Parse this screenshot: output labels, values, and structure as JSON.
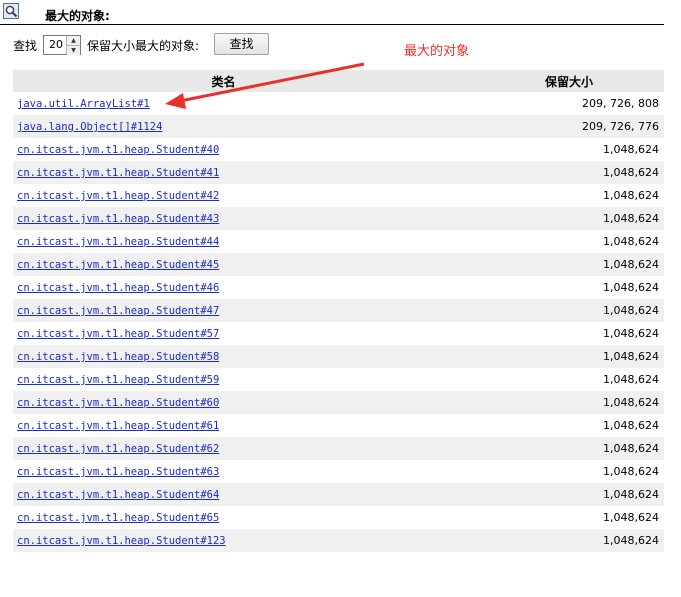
{
  "header": {
    "title": "最大的对象:",
    "icon": "magnifier-icon"
  },
  "search": {
    "label_find": "查找",
    "count": "20",
    "label_suffix": "保留大小最大的对象:",
    "button": "查找"
  },
  "annotation": {
    "text": "最大的对象",
    "color": "#e8312a"
  },
  "table": {
    "columns": [
      "类名",
      "保留大小"
    ],
    "rows": [
      {
        "name": "java.util.ArrayList#1",
        "size": "209, 726, 808"
      },
      {
        "name": "java.lang.Object[]#1124",
        "size": "209, 726, 776"
      },
      {
        "name": "cn.itcast.jvm.t1.heap.Student#40",
        "size": "1,048,624"
      },
      {
        "name": "cn.itcast.jvm.t1.heap.Student#41",
        "size": "1,048,624"
      },
      {
        "name": "cn.itcast.jvm.t1.heap.Student#42",
        "size": "1,048,624"
      },
      {
        "name": "cn.itcast.jvm.t1.heap.Student#43",
        "size": "1,048,624"
      },
      {
        "name": "cn.itcast.jvm.t1.heap.Student#44",
        "size": "1,048,624"
      },
      {
        "name": "cn.itcast.jvm.t1.heap.Student#45",
        "size": "1,048,624"
      },
      {
        "name": "cn.itcast.jvm.t1.heap.Student#46",
        "size": "1,048,624"
      },
      {
        "name": "cn.itcast.jvm.t1.heap.Student#47",
        "size": "1,048,624"
      },
      {
        "name": "cn.itcast.jvm.t1.heap.Student#57",
        "size": "1,048,624"
      },
      {
        "name": "cn.itcast.jvm.t1.heap.Student#58",
        "size": "1,048,624"
      },
      {
        "name": "cn.itcast.jvm.t1.heap.Student#59",
        "size": "1,048,624"
      },
      {
        "name": "cn.itcast.jvm.t1.heap.Student#60",
        "size": "1,048,624"
      },
      {
        "name": "cn.itcast.jvm.t1.heap.Student#61",
        "size": "1,048,624"
      },
      {
        "name": "cn.itcast.jvm.t1.heap.Student#62",
        "size": "1,048,624"
      },
      {
        "name": "cn.itcast.jvm.t1.heap.Student#63",
        "size": "1,048,624"
      },
      {
        "name": "cn.itcast.jvm.t1.heap.Student#64",
        "size": "1,048,624"
      },
      {
        "name": "cn.itcast.jvm.t1.heap.Student#65",
        "size": "1,048,624"
      },
      {
        "name": "cn.itcast.jvm.t1.heap.Student#123",
        "size": "1,048,624"
      }
    ]
  }
}
